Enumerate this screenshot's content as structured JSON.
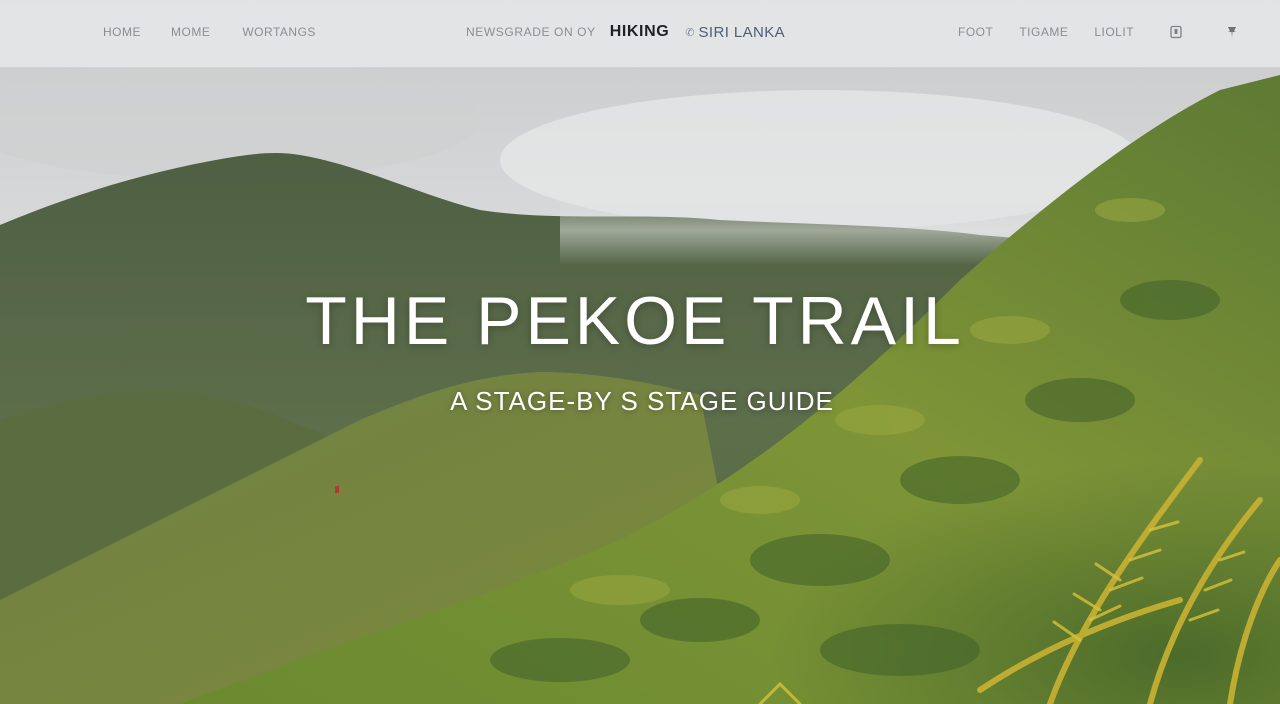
{
  "nav": {
    "left_links": [
      "HOME",
      "MOME",
      "WORTANGS"
    ],
    "brand_prefix": "NEWSGRADE ON OY",
    "brand_main": "HIKING",
    "brand_mark": "✆",
    "brand_sub": "SIRI LANKA",
    "right_links": [
      "FOOT",
      "TIGAME",
      "LIOLIT"
    ],
    "icons": [
      "bookmark-icon",
      "pin-icon"
    ]
  },
  "hero": {
    "title": "THE PEKOE TRAIL",
    "subtitle": "A STAGE-BY S STAGE GUIDE"
  },
  "colors": {
    "nav_bg": "#e4e5e6",
    "nav_text": "#8a8d92",
    "brand_dark": "#1e2226",
    "brand_blue": "#4d5e75",
    "sky": "#d9dadb",
    "hill_far": "#5a6e4a",
    "grass": "#7a8f3a"
  }
}
